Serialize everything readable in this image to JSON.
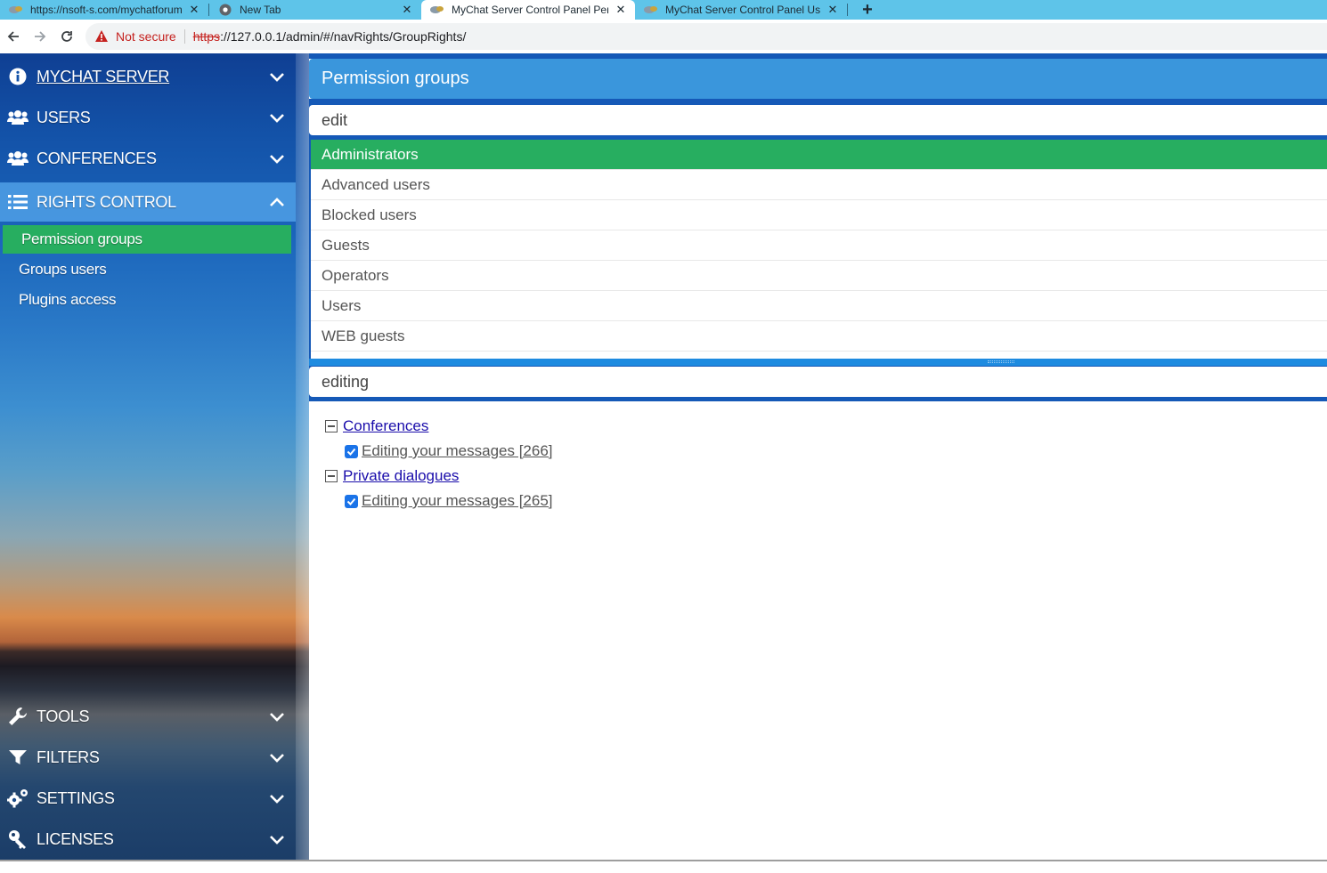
{
  "browser": {
    "tabs": [
      {
        "title": "https://nsoft-s.com/mychatforum",
        "active": false
      },
      {
        "title": "New Tab",
        "active": false
      },
      {
        "title": "MyChat Server Control Panel Permission groups",
        "active": true
      },
      {
        "title": "MyChat Server Control Panel Users",
        "active": false
      }
    ],
    "close_glyph": "✕",
    "new_tab_glyph": "+",
    "security_label": "Not secure",
    "url_scheme": "https",
    "url_rest": "://127.0.0.1/admin/#/navRights/GroupRights/"
  },
  "sidebar": {
    "sections": [
      {
        "label": "MYCHAT SERVER",
        "icon": "info-circle-icon"
      },
      {
        "label": "USERS",
        "icon": "users-icon"
      },
      {
        "label": "CONFERENCES",
        "icon": "users-icon"
      },
      {
        "label": "RIGHTS CONTROL",
        "icon": "list-icon"
      }
    ],
    "rights_submenu": [
      {
        "label": "Permission groups",
        "active": true
      },
      {
        "label": "Groups users",
        "active": false
      },
      {
        "label": "Plugins access",
        "active": false
      }
    ],
    "bottom_sections": [
      {
        "label": "TOOLS",
        "icon": "wrench-icon"
      },
      {
        "label": "FILTERS",
        "icon": "filter-icon"
      },
      {
        "label": "SETTINGS",
        "icon": "gears-icon"
      },
      {
        "label": "LICENSES",
        "icon": "key-icon"
      }
    ]
  },
  "main": {
    "title": "Permission groups",
    "group_filter": "edit",
    "groups": [
      {
        "label": "Administrators",
        "active": true
      },
      {
        "label": "Advanced users",
        "active": false
      },
      {
        "label": "Blocked users",
        "active": false
      },
      {
        "label": "Guests",
        "active": false
      },
      {
        "label": "Operators",
        "active": false
      },
      {
        "label": "Users",
        "active": false
      },
      {
        "label": "WEB guests",
        "active": false
      }
    ],
    "rights_filter": "editing",
    "tree": [
      {
        "label": "Conferences",
        "children": [
          {
            "label": " Editing your messages [266]",
            "checked": true
          }
        ]
      },
      {
        "label": "Private dialogues",
        "children": [
          {
            "label": " Editing your messages [265]",
            "checked": true
          }
        ]
      }
    ]
  },
  "colors": {
    "accent_green": "#27ae60",
    "panel_blue": "#3a96dc",
    "dark_blue": "#1559b7",
    "tab_strip": "#5ec4e9"
  }
}
